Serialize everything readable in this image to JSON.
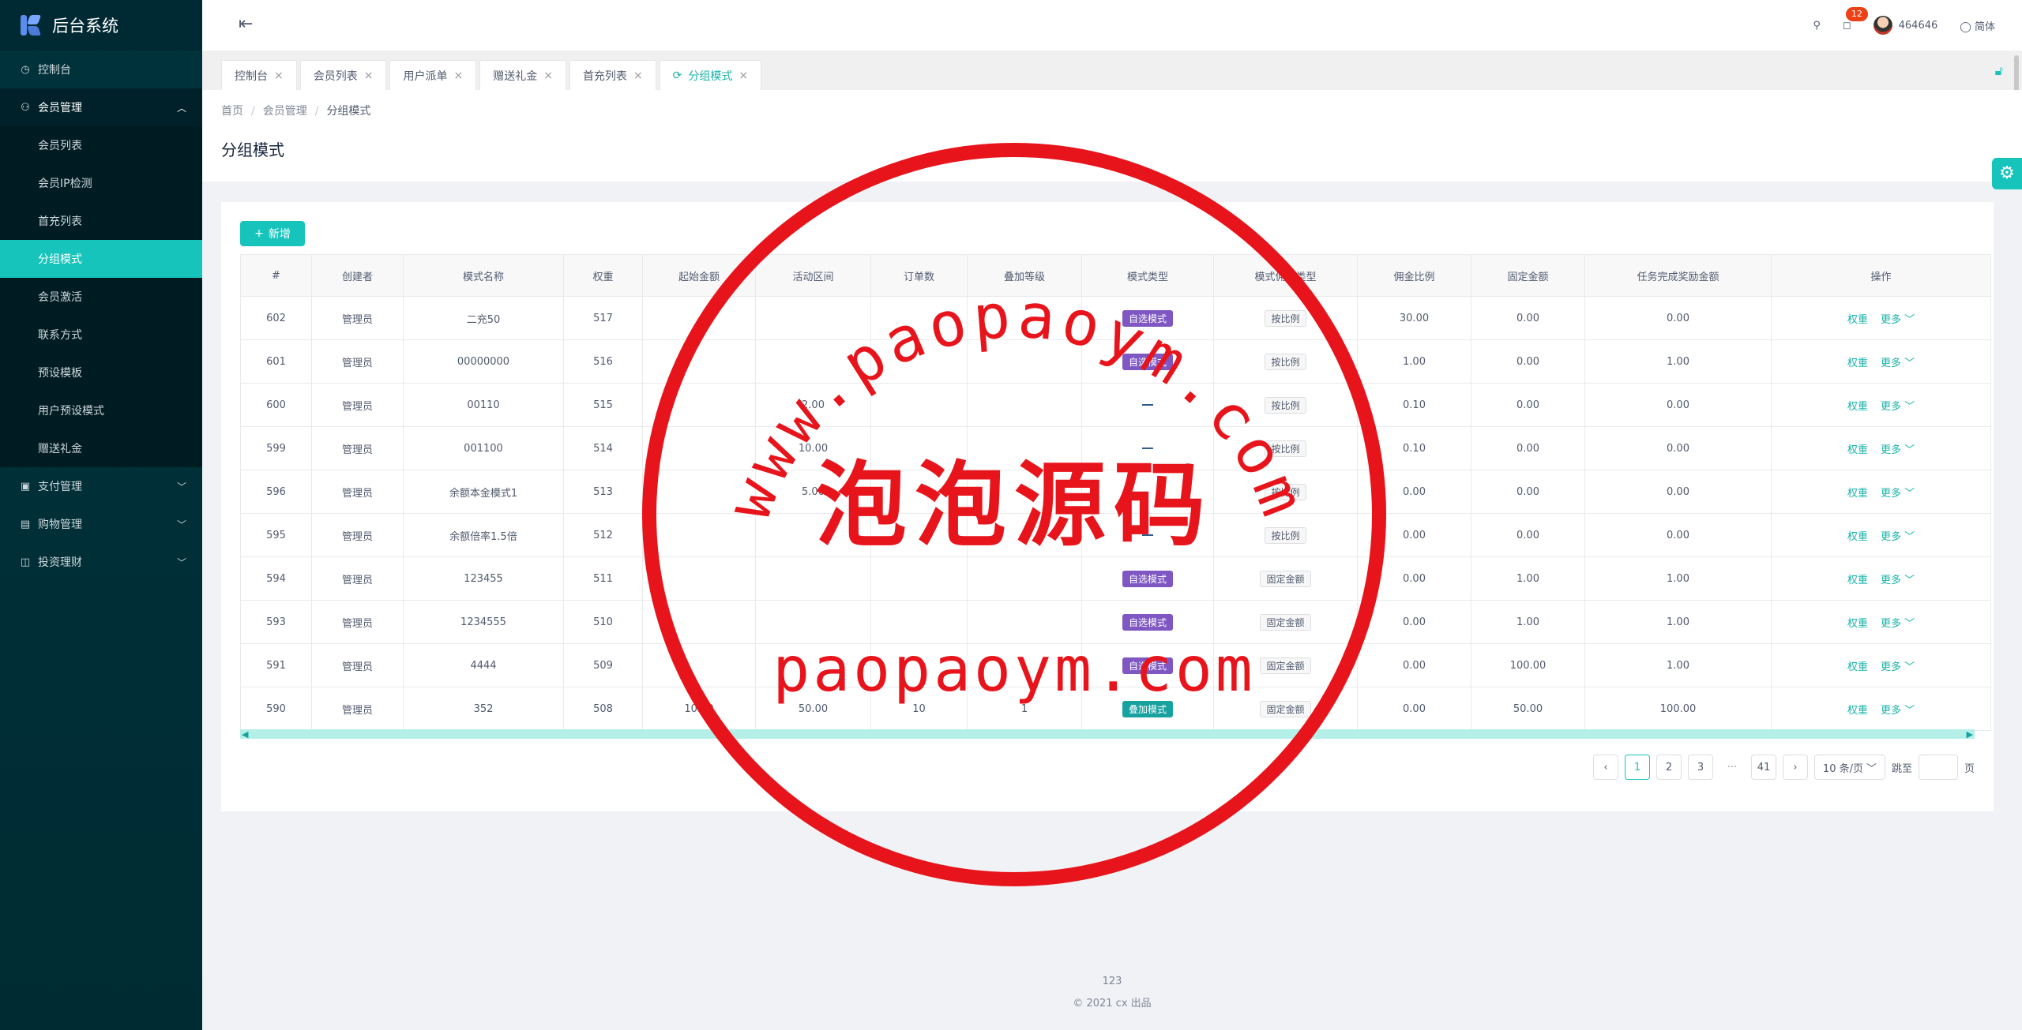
{
  "app": {
    "title": "后台系统"
  },
  "sidebar": {
    "items": [
      {
        "label": "控制台",
        "icon": "dashboard-icon"
      },
      {
        "label": "会员管理",
        "icon": "user-icon"
      },
      {
        "label": "支付管理",
        "icon": "pay-icon"
      },
      {
        "label": "购物管理",
        "icon": "shop-icon"
      },
      {
        "label": "投资理财",
        "icon": "finance-icon"
      }
    ],
    "sub_items": [
      "会员列表",
      "会员IP检测",
      "首充列表",
      "分组模式",
      "会员激活",
      "联系方式",
      "预设模板",
      "用户预设模式",
      "赠送礼金"
    ],
    "active_sub": "分组模式"
  },
  "header": {
    "notification_count": "12",
    "username": "464646",
    "language": "简体"
  },
  "tabs": [
    "控制台",
    "会员列表",
    "用户派单",
    "赠送礼金",
    "首充列表",
    "分组模式"
  ],
  "breadcrumb": {
    "home": "首页",
    "parent": "会员管理",
    "current": "分组模式"
  },
  "page_title": "分组模式",
  "add_button": "新增",
  "table": {
    "columns": [
      "#",
      "创建者",
      "模式名称",
      "权重",
      "起始金额",
      "活动区间",
      "订单数",
      "叠加等级",
      "模式类型",
      "模式佣金类型",
      "佣金比例",
      "固定金额",
      "任务完成奖励金额",
      "操作"
    ],
    "rows": [
      [
        "602",
        "管理员",
        "二充50",
        "517",
        "",
        "",
        "",
        "",
        "自选模式",
        "按比例",
        "30.00",
        "0.00",
        "0.00"
      ],
      [
        "601",
        "管理员",
        "00000000",
        "516",
        "",
        "",
        "",
        "",
        "自选模式",
        "按比例",
        "1.00",
        "0.00",
        "1.00"
      ],
      [
        "600",
        "管理员",
        "00110",
        "515",
        "",
        "2.00",
        "",
        "",
        "—",
        "按比例",
        "0.10",
        "0.00",
        "0.00"
      ],
      [
        "599",
        "管理员",
        "001100",
        "514",
        "",
        "10.00",
        "",
        "",
        "—",
        "按比例",
        "0.10",
        "0.00",
        "0.00"
      ],
      [
        "596",
        "管理员",
        "余额本金模式1",
        "513",
        "",
        "5.00",
        "",
        "",
        "",
        "按比例",
        "0.00",
        "0.00",
        "0.00"
      ],
      [
        "595",
        "管理员",
        "余额倍率1.5倍",
        "512",
        "",
        "",
        "",
        "",
        "—",
        "按比例",
        "0.00",
        "0.00",
        "0.00"
      ],
      [
        "594",
        "管理员",
        "123455",
        "511",
        "",
        "",
        "",
        "",
        "自选模式",
        "固定金额",
        "0.00",
        "1.00",
        "1.00"
      ],
      [
        "593",
        "管理员",
        "1234555",
        "510",
        "",
        "",
        "",
        "",
        "自选模式",
        "固定金额",
        "0.00",
        "1.00",
        "1.00"
      ],
      [
        "591",
        "管理员",
        "4444",
        "509",
        "",
        "",
        "",
        "",
        "自选模式",
        "固定金额",
        "0.00",
        "100.00",
        "1.00"
      ],
      [
        "590",
        "管理员",
        "352",
        "508",
        "10.00",
        "50.00",
        "10",
        "1",
        "叠加模式",
        "固定金额",
        "0.00",
        "50.00",
        "100.00"
      ]
    ],
    "op_weight": "权重",
    "op_more": "更多"
  },
  "pagination": {
    "pages": [
      "1",
      "2",
      "3",
      "41"
    ],
    "ellipsis": "···",
    "page_size": "10 条/页",
    "jump_label": "跳至",
    "page_unit": "页"
  },
  "footer": {
    "line1": "123",
    "line2": "© 2021 cx 出品"
  },
  "watermark": {
    "top_text": "www.paopaoym.com",
    "middle_text": "泡泡源码",
    "bottom_text": "paopaoym.com",
    "color": "#e8141b"
  },
  "colors": {
    "accent": "#17c4bb",
    "sidebar": "#00303f",
    "purple_tag": "#7e57c2",
    "teal_tag": "#17a2a0"
  }
}
